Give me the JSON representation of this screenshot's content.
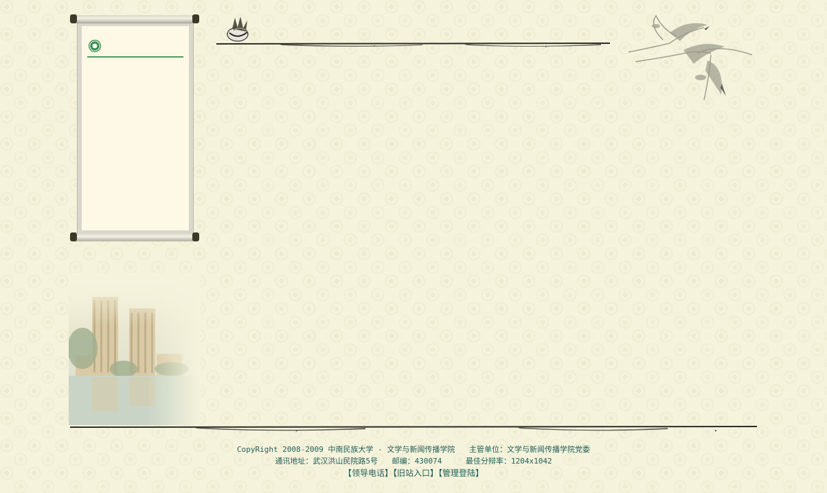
{
  "footer": {
    "copyright": "CopyRight 2008-2009 中南民族大学 - 文学与新闻传播学院",
    "host": "主管单位：文学与新闻传播学院党委",
    "address": "通讯地址：武汉洪山民院路5号",
    "postcode": "邮编：430074",
    "resolution": "最佳分辩率：1204x1042",
    "links": [
      "【领导电话】",
      "【旧站入口】",
      "【管理登陆】"
    ]
  },
  "icons": {
    "seal": "university-seal-icon",
    "ink": "ink-painting-icon",
    "cranes": "cranes-painting",
    "building": "campus-building-photo"
  },
  "colors": {
    "background": "#f5f3dc",
    "accent_green": "#2f8a46",
    "footer_text": "#1f5f5a"
  }
}
